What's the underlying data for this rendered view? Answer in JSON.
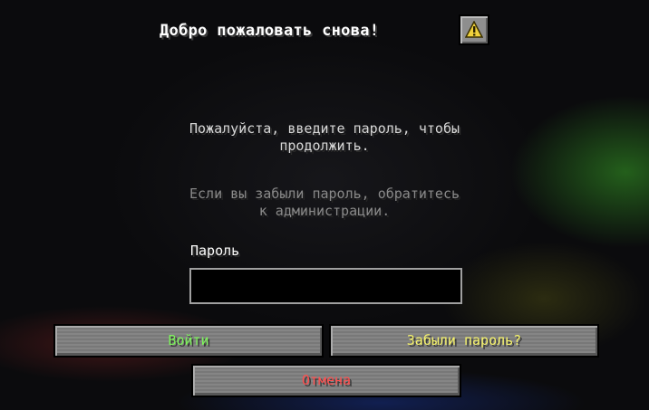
{
  "header": {
    "title": "Добро пожаловать снова!",
    "warning_icon": "warning-triangle-icon"
  },
  "messages": {
    "prompt": "Пожалуйста, введите пароль, чтобы\nпродолжить.",
    "forgot_hint": "Если вы забыли пароль, обратитесь\nк администрации."
  },
  "password": {
    "label": "Пароль",
    "value": "",
    "placeholder": ""
  },
  "buttons": {
    "login": "Войти",
    "forgot": "Забыли пароль?",
    "cancel": "Отмена"
  },
  "colors": {
    "login_text": "#7cf25a",
    "forgot_text": "#f5f26a",
    "cancel_text": "#ff4e4e",
    "warning_yellow": "#f0d23c"
  }
}
